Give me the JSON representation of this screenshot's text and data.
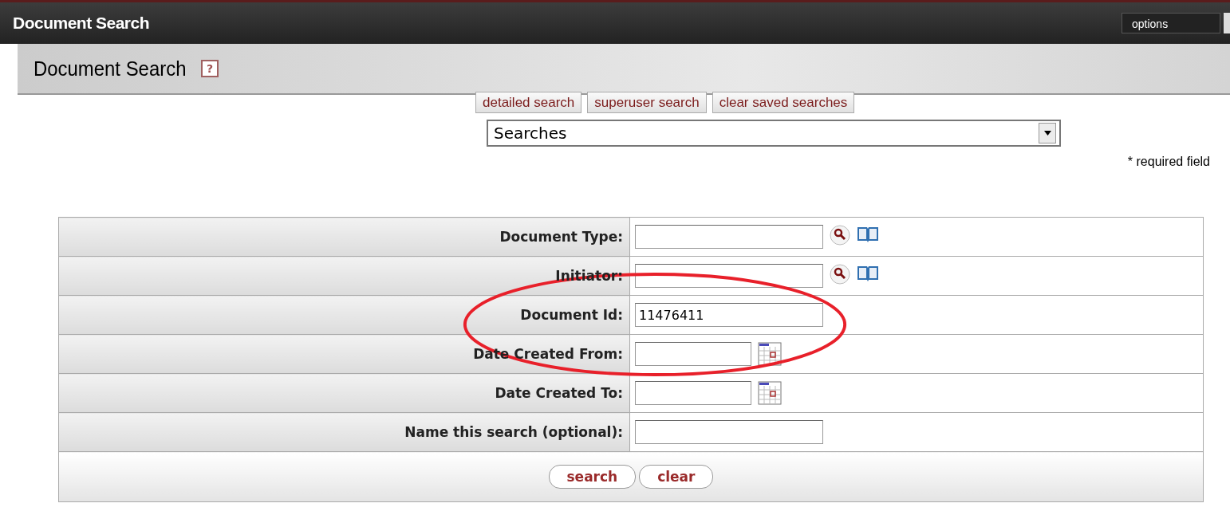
{
  "window": {
    "title": "Document Search",
    "options": {
      "label": "options"
    }
  },
  "header": {
    "title": "Document Search",
    "help": "?"
  },
  "tabs": [
    {
      "label": "detailed search"
    },
    {
      "label": "superuser search"
    },
    {
      "label": "clear saved searches"
    }
  ],
  "saved_searches": {
    "value": "Searches"
  },
  "required_note": "* required field",
  "form": {
    "fields": [
      {
        "label": "Document Type:",
        "kind": "lookup"
      },
      {
        "label": "Initiator:",
        "kind": "lookup"
      },
      {
        "label": "Document Id:",
        "kind": "text",
        "value": "11476411"
      },
      {
        "label": "Date Created From:",
        "kind": "date"
      },
      {
        "label": "Date Created To:",
        "kind": "date"
      },
      {
        "label": "Name this search (optional):",
        "kind": "text"
      }
    ],
    "buttons": [
      {
        "label": "search"
      },
      {
        "label": "clear"
      }
    ]
  },
  "annotation": {
    "kind": "ellipse",
    "color": "#e8202a"
  }
}
